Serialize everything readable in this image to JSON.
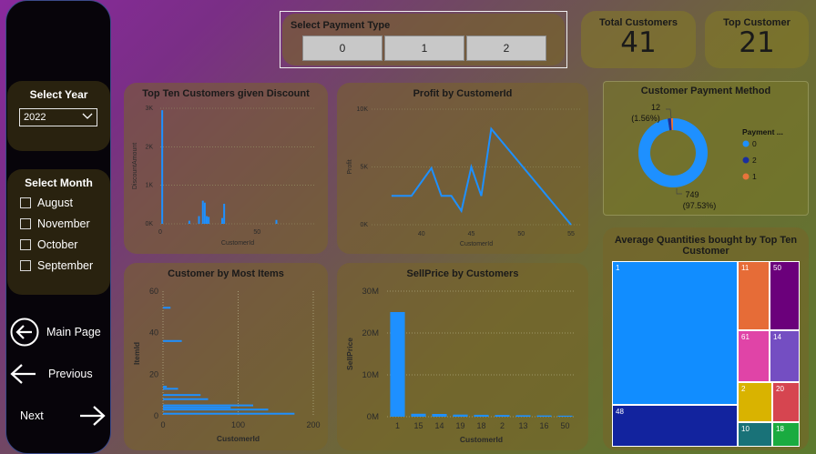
{
  "sidebar": {
    "year_title": "Select Year",
    "year_value": "2022",
    "month_title": "Select Month",
    "months": [
      "August",
      "November",
      "October",
      "September"
    ],
    "nav": {
      "main": "Main Page",
      "previous": "Previous",
      "next": "Next"
    }
  },
  "payment": {
    "title": "Select Payment Type",
    "options": [
      "0",
      "1",
      "2"
    ]
  },
  "kpis": {
    "total_customers": {
      "label": "Total Customers",
      "value": "41"
    },
    "top_customer": {
      "label": "Top Customer",
      "value": "21"
    }
  },
  "colors": {
    "series": "#1e90ff",
    "sidebar": "#07040a"
  },
  "chart_data": [
    {
      "id": "discount",
      "type": "bar",
      "title": "Top Ten Customers given Discount",
      "xlabel": "CustomerId",
      "ylabel": "DiscountAmount",
      "xlim": [
        0,
        80
      ],
      "ylim": [
        0,
        3000
      ],
      "xticks": [
        "0",
        "50"
      ],
      "yticks": [
        "0K",
        "1K",
        "2K",
        "3K"
      ],
      "x": [
        1,
        15,
        20,
        22,
        23,
        24,
        25,
        32,
        33,
        60
      ],
      "values": [
        2950,
        80,
        200,
        600,
        550,
        200,
        180,
        150,
        520,
        100
      ]
    },
    {
      "id": "profit",
      "type": "line",
      "title": "Profit by CustomerId",
      "xlabel": "CustomerId",
      "ylabel": "Profit",
      "xlim": [
        35,
        56
      ],
      "ylim": [
        0,
        10000
      ],
      "xticks": [
        "40",
        "45",
        "50",
        "55"
      ],
      "yticks": [
        "0K",
        "5K",
        "10K"
      ],
      "x": [
        37,
        39,
        41,
        42,
        43,
        44,
        45,
        46,
        47,
        55
      ],
      "values": [
        2500,
        2500,
        4900,
        2500,
        2500,
        1200,
        5000,
        2500,
        8300,
        0
      ]
    },
    {
      "id": "items",
      "type": "bar",
      "orientation": "horizontal",
      "title": "Customer by Most Items",
      "xlabel": "CustomerId",
      "ylabel": "ItemId",
      "xlim": [
        0,
        200
      ],
      "ylim": [
        0,
        60
      ],
      "xticks": [
        "0",
        "100",
        "200"
      ],
      "yticks": [
        "0",
        "20",
        "40",
        "60"
      ],
      "y": [
        52,
        36,
        14,
        13,
        10,
        8,
        5,
        4,
        3,
        1
      ],
      "values": [
        10,
        25,
        5,
        20,
        50,
        60,
        120,
        90,
        140,
        175
      ]
    },
    {
      "id": "sellprice",
      "type": "bar",
      "title": "SellPrice by Customers",
      "xlabel": "CustomerId",
      "ylabel": "SellPrice",
      "ylim": [
        0,
        30000000
      ],
      "yticks": [
        "0M",
        "10M",
        "20M",
        "30M"
      ],
      "categories": [
        "1",
        "15",
        "14",
        "19",
        "18",
        "2",
        "13",
        "16",
        "50"
      ],
      "values": [
        25000000,
        700000,
        650000,
        500000,
        450000,
        400000,
        350000,
        300000,
        250000
      ]
    },
    {
      "id": "payment-method",
      "type": "pie",
      "title": "Customer Payment Method",
      "legend_title": "Payment ...",
      "legend_position": "right",
      "slices": [
        {
          "name": "0",
          "value": 749,
          "color": "#1e90ff"
        },
        {
          "name": "2",
          "value": 12,
          "color": "#1a2f9e"
        },
        {
          "name": "1",
          "value": 7,
          "color": "#e8743b"
        }
      ],
      "labels": [
        {
          "count": "12",
          "pct": "(1.56%)"
        },
        {
          "count": "749",
          "pct": "(97.53%)"
        }
      ]
    },
    {
      "id": "treemap",
      "type": "table",
      "title": "Average Quantities bought by Top Ten Customer",
      "cells": [
        {
          "label": "1",
          "color": "#118dff"
        },
        {
          "label": "48",
          "color": "#12239e"
        },
        {
          "label": "11",
          "color": "#e66c37"
        },
        {
          "label": "50",
          "color": "#6b007b"
        },
        {
          "label": "61",
          "color": "#e044a7"
        },
        {
          "label": "14",
          "color": "#744ec2"
        },
        {
          "label": "2",
          "color": "#d9b300"
        },
        {
          "label": "20",
          "color": "#d64550"
        },
        {
          "label": "10",
          "color": "#197278"
        },
        {
          "label": "18",
          "color": "#1aab40"
        }
      ]
    }
  ]
}
